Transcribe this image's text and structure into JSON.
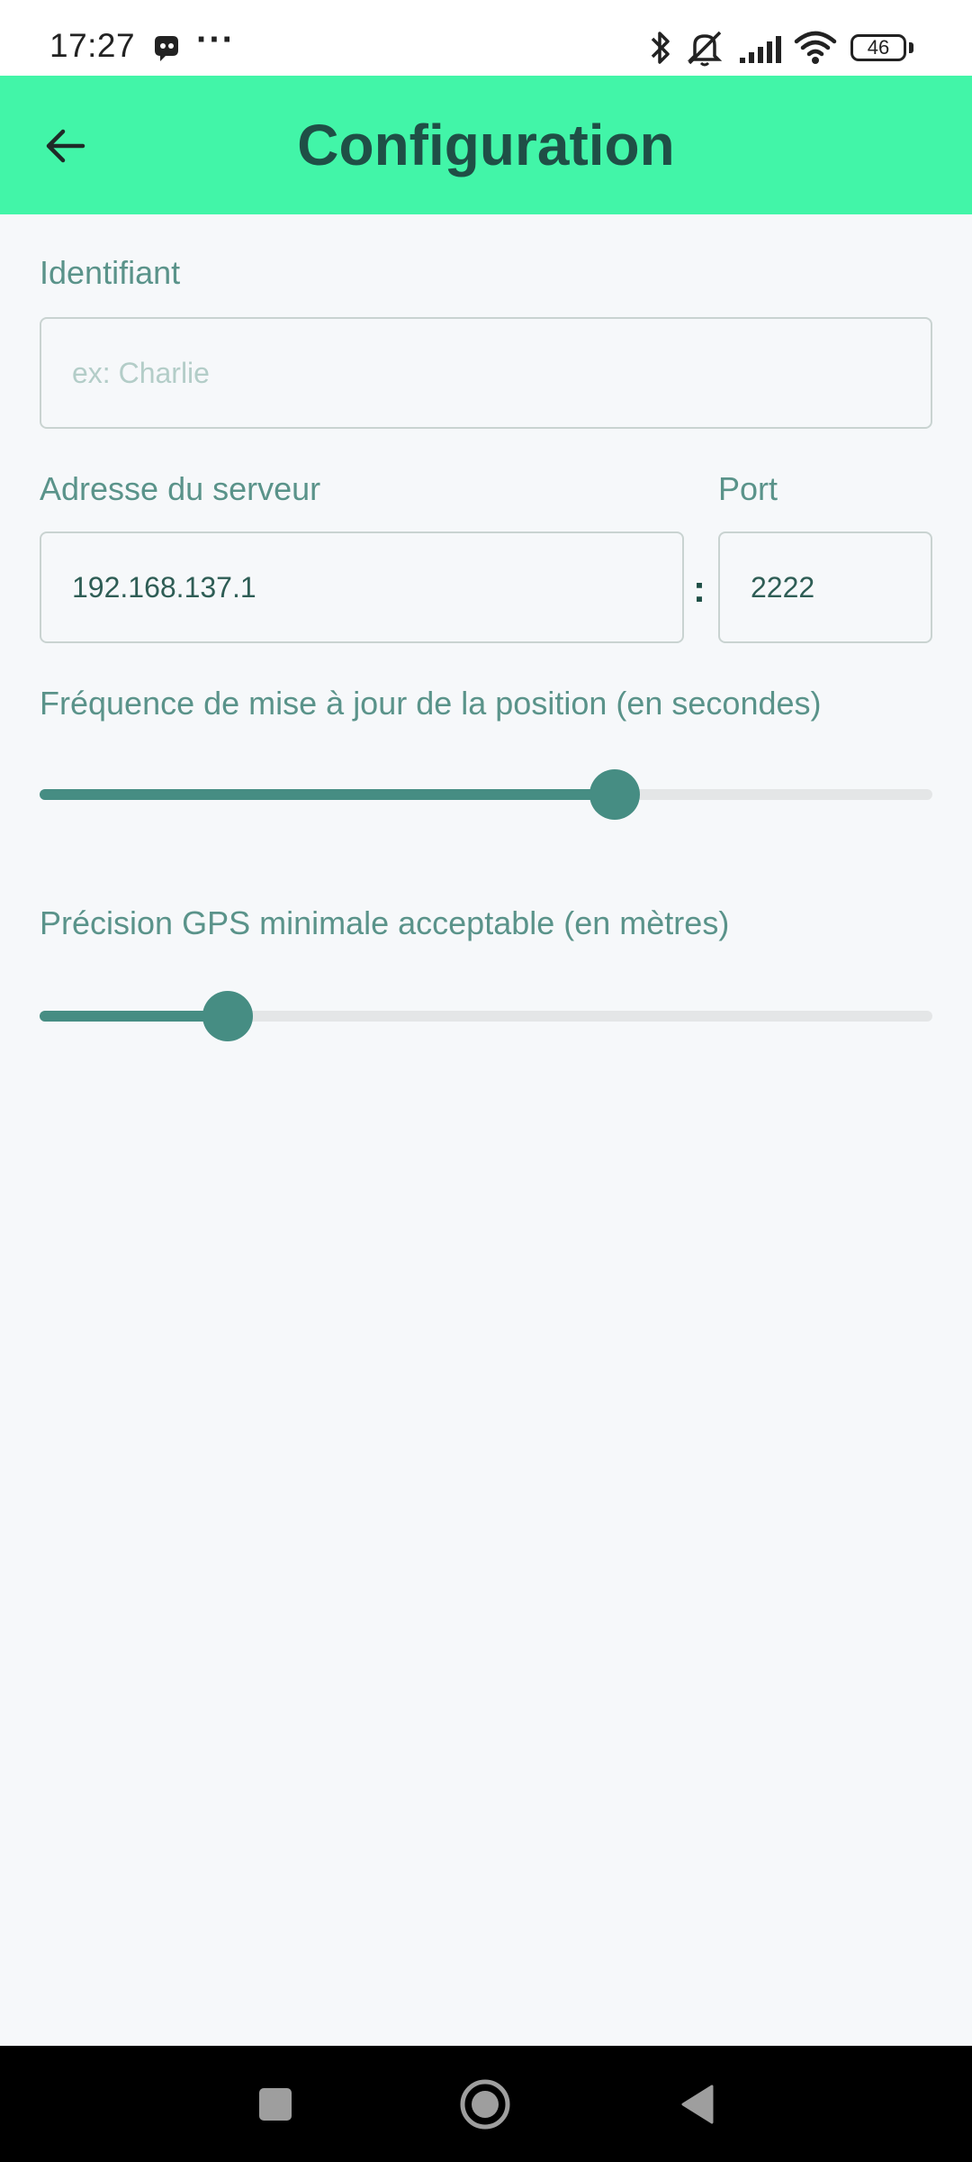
{
  "status_bar": {
    "time": "17:27",
    "dots": "···",
    "battery": "46",
    "icons": [
      "app-notification-icon",
      "bluetooth-icon",
      "silent-icon",
      "signal-icon",
      "wifi-icon",
      "battery-icon"
    ]
  },
  "app_bar": {
    "title": "Configuration",
    "back_icon": "arrow-left-icon",
    "color": "#42f5a8"
  },
  "form": {
    "identifiant": {
      "label": "Identifiant",
      "value": "",
      "placeholder": "ex: Charlie"
    },
    "server": {
      "label": "Adresse du serveur",
      "value": "192.168.137.1"
    },
    "separator": ":",
    "port": {
      "label": "Port",
      "value": "2222"
    },
    "frequency": {
      "label": "Fréquence de mise à jour de la position (en secondes)",
      "level": 0.644
    },
    "precision": {
      "label": "Précision GPS minimale acceptable (en mètres)",
      "level": 0.211
    }
  },
  "colors": {
    "accent": "#468d83",
    "label": "#5a938a",
    "title": "#1f4f46"
  },
  "nav_bar": {
    "icons": [
      "recents-square-icon",
      "home-circle-icon",
      "back-triangle-icon"
    ]
  }
}
